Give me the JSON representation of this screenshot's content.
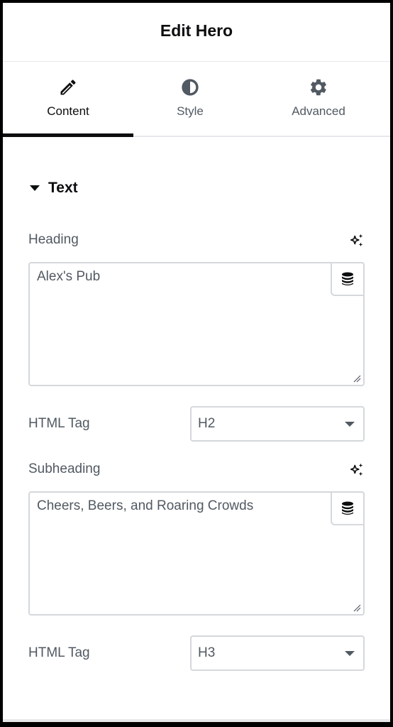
{
  "header": {
    "title": "Edit Hero"
  },
  "tabs": [
    {
      "label": "Content",
      "icon": "pencil-icon",
      "active": true
    },
    {
      "label": "Style",
      "icon": "half-circle-contrast-icon",
      "active": false
    },
    {
      "label": "Advanced",
      "icon": "gear-icon",
      "active": false
    }
  ],
  "section": {
    "label": "Text",
    "expanded": true
  },
  "heading": {
    "label": "Heading",
    "value": "Alex's Pub",
    "ai_icon": "sparkle-icon",
    "dynamic_icon": "database-icon"
  },
  "heading_tag": {
    "label": "HTML Tag",
    "value": "H2"
  },
  "subheading": {
    "label": "Subheading",
    "value": "Cheers, Beers, and Roaring Crowds",
    "ai_icon": "sparkle-icon",
    "dynamic_icon": "database-icon"
  },
  "subheading_tag": {
    "label": "HTML Tag",
    "value": "H3"
  },
  "colors": {
    "text_dark": "#0c0d0e",
    "text_muted": "#515962",
    "border": "#d5d8dc"
  }
}
